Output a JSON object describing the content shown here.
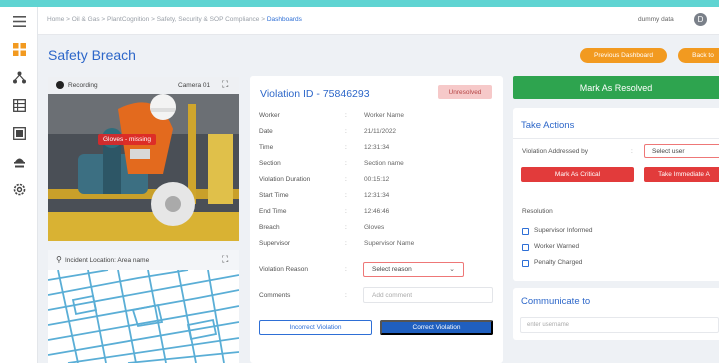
{
  "breadcrumb": {
    "items": [
      "Home",
      "Oil & Gas",
      "PlantCognition",
      "Safety, Security & SOP Compliance",
      "Dashboards"
    ],
    "separator": ">"
  },
  "user": {
    "name": "dummy data",
    "avatar_initial": "D"
  },
  "page": {
    "title": "Safety Breach",
    "prev_button": "Previous Dashboard",
    "back_button": "Back to"
  },
  "camera": {
    "status": "Recording",
    "name": "Camera 01",
    "detection_label": "Gloves - missing"
  },
  "map": {
    "location_label": "Incident Location: Area name"
  },
  "violation": {
    "id": "Violation ID - 75846293",
    "status": "Unresolved",
    "fields": [
      {
        "label": "Worker",
        "value": "Worker Name"
      },
      {
        "label": "Date",
        "value": "21/11/2022"
      },
      {
        "label": "Time",
        "value": "12:31:34"
      },
      {
        "label": "Section",
        "value": "Section name"
      },
      {
        "label": "Violation Duration",
        "value": "00:15:12"
      },
      {
        "label": "Start Time",
        "value": "12:31:34"
      },
      {
        "label": "End Time",
        "value": "12:46:46"
      },
      {
        "label": "Breach",
        "value": "Gloves"
      },
      {
        "label": "Supervisor",
        "value": "Supervisor Name"
      }
    ],
    "reason_label": "Violation Reason",
    "reason_placeholder": "Select reason",
    "comments_label": "Comments",
    "comments_placeholder": "Add comment",
    "incorrect_button": "Incorrect Violation",
    "correct_button": "Correct Violation"
  },
  "actions": {
    "resolve_button": "Mark As Resolved",
    "title": "Take Actions",
    "addressed_label": "Violation Addressed by",
    "select_user_placeholder": "Select user",
    "critical_button": "Mark As Critical",
    "immediate_button": "Take Immediate A",
    "resolution_label": "Resolution",
    "resolutions": [
      "Supervisor Informed",
      "Worker Warned",
      "Penalty Charged"
    ]
  },
  "communicate": {
    "title": "Communicate to",
    "placeholder": "enter username"
  },
  "colors": {
    "accent_blue": "#2d67c9",
    "orange": "#f29a20",
    "green": "#2ea44f",
    "red": "#e23b3b",
    "teal_strip": "#5fd4d2"
  }
}
